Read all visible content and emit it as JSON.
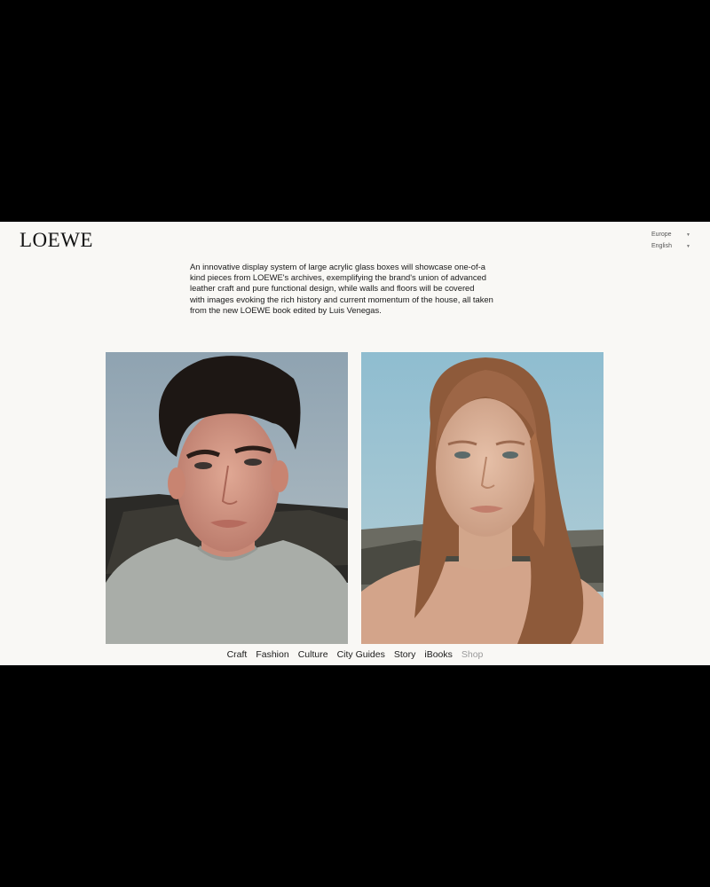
{
  "header": {
    "logo": "LOEWE",
    "region": "Europe",
    "language": "English"
  },
  "intro_text": "An innovative display system of large acrylic glass boxes will showcase one-of-a\nkind pieces from LOEWE's archives, exemplifying the brand's union of advanced\nleather craft and pure functional design, while walls and floors will be covered\nwith images evoking the rich history and current momentum of the house, all taken\nfrom the new LOEWE book edited by Luis Venegas.",
  "nav": {
    "items": [
      "Craft",
      "Fashion",
      "Culture",
      "City Guides",
      "Story",
      "iBooks",
      "Shop"
    ]
  },
  "colors": {
    "frame": "#000000",
    "page_background": "#f9f8f5",
    "text": "#1a1a1a",
    "muted_nav": "#9a9a9a"
  }
}
